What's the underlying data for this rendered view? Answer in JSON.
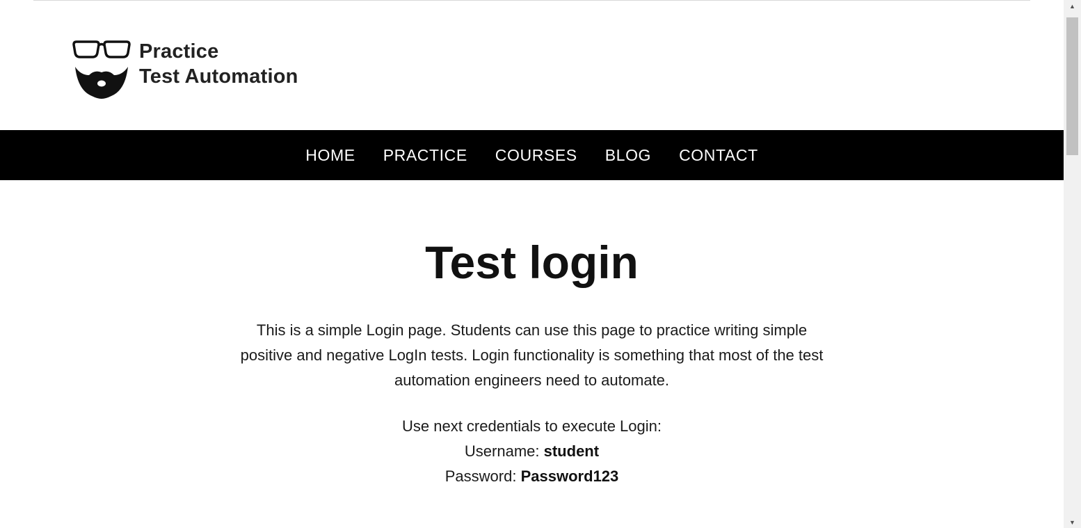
{
  "header": {
    "logo_line1": "Practice",
    "logo_line2": "Test Automation"
  },
  "nav": {
    "items": [
      {
        "label": "HOME"
      },
      {
        "label": "PRACTICE"
      },
      {
        "label": "COURSES"
      },
      {
        "label": "BLOG"
      },
      {
        "label": "CONTACT"
      }
    ]
  },
  "main": {
    "title": "Test login",
    "intro": "This is a simple Login page. Students can use this page to practice writing simple positive and negative LogIn tests. Login functionality is something that most of the test automation engineers need to automate.",
    "credentials_intro": "Use next credentials to execute Login:",
    "username_label": "Username:",
    "username_value": "student",
    "password_label": "Password:",
    "password_value": "Password123"
  },
  "icons": {
    "logo": "glasses-beard-logo-icon",
    "scroll_up": "scroll-up-arrow-icon",
    "scroll_down": "scroll-down-arrow-icon"
  },
  "colors": {
    "nav_background": "#000000",
    "nav_text": "#ffffff",
    "text": "#111111",
    "scroll_track": "#f1f1f1",
    "scroll_thumb": "#c1c1c1"
  }
}
